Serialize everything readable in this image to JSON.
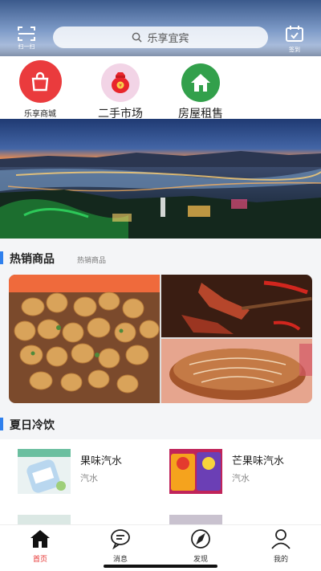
{
  "header": {
    "scan_label": "扫一扫",
    "search_placeholder": "乐享宜宾",
    "checkin_label": "签到"
  },
  "categories": [
    {
      "label": "乐享商城",
      "icon": "shopping-bag-icon",
      "color": "#ea3b3d"
    },
    {
      "label": "二手市场",
      "icon": "money-bag-icon",
      "color": "#f2d4e6"
    },
    {
      "label": "房屋租售",
      "icon": "house-icon",
      "color": "#32a04b"
    }
  ],
  "banner": {
    "icon": "city-night-skyline-banner"
  },
  "hot": {
    "title": "热销商品",
    "subtitle": "热销商品",
    "images": [
      "fried-snack-photo",
      "spicy-jerky-photo",
      "bread-loaf-photo"
    ]
  },
  "summer": {
    "title": "夏日冷饮",
    "items": [
      {
        "name": "果味汽水",
        "tag": "汽水",
        "image": "bottled-soda-photo"
      },
      {
        "name": "芒果味汽水",
        "tag": "汽水",
        "image": "candy-pack-photo"
      }
    ],
    "partial_items": [
      "item-3-partial",
      "item-4-partial"
    ]
  },
  "nav": {
    "items": [
      {
        "label": "首页",
        "icon": "home-icon",
        "active": true
      },
      {
        "label": "消息",
        "icon": "message-icon",
        "active": false
      },
      {
        "label": "发现",
        "icon": "compass-icon",
        "active": false
      },
      {
        "label": "我的",
        "icon": "user-icon",
        "active": false
      }
    ],
    "active_color": "#e6312f"
  },
  "colors": {
    "accent": "#2f80ed",
    "brand_red": "#ea3b3d"
  }
}
